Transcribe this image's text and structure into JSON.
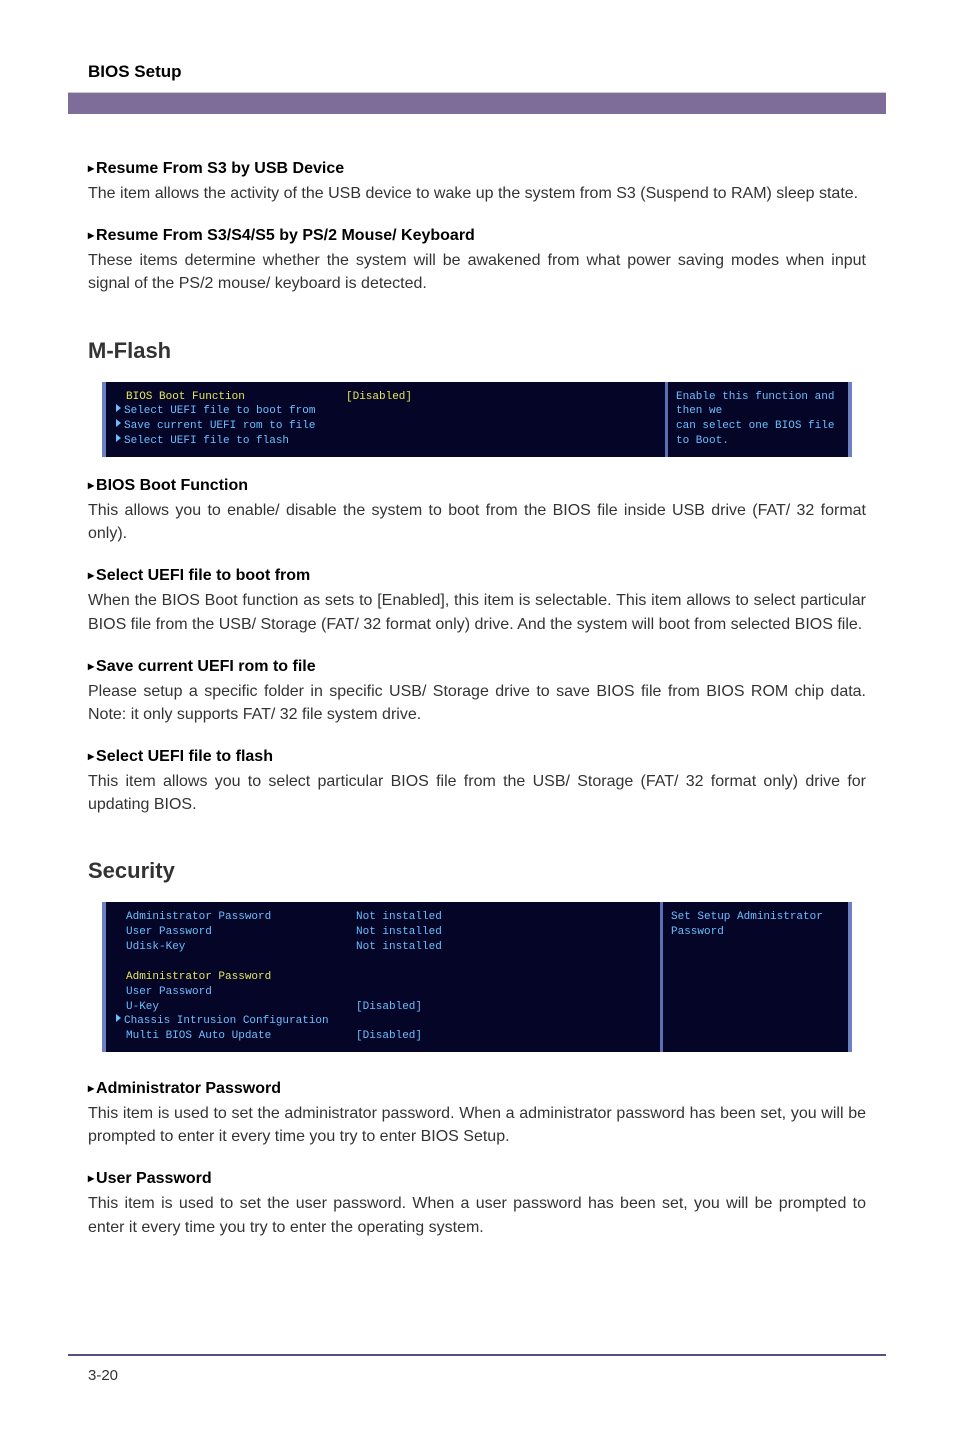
{
  "header": {
    "title": "BIOS Setup"
  },
  "intro": {
    "item1_title": "Resume From S3 by USB Device",
    "item1_text": "The item allows the activity of the USB device to wake up the system from S3 (Suspend to RAM) sleep state.",
    "item2_title": "Resume From S3/S4/S5 by PS/2 Mouse/ Keyboard",
    "item2_text": "These items determine whether the system will be awakened from what power saving modes when input signal of the PS/2 mouse/ keyboard is detected."
  },
  "mflash": {
    "heading": "M-Flash",
    "box": {
      "r1_label": "BIOS Boot Function",
      "r1_value": "[Disabled]",
      "r2_label": "Select UEFI file to boot from",
      "r3_label": "Save current UEFI rom to file",
      "r4_label": "Select UEFI file to flash",
      "help1": "Enable this function and then we",
      "help2": "can select one BIOS file to Boot."
    },
    "item1_title": "BIOS Boot Function",
    "item1_text": "This allows you to enable/ disable the system to boot from the BIOS file inside USB drive (FAT/ 32 format only).",
    "item2_title": "Select UEFI file to boot from",
    "item2_text": "When the BIOS Boot function as sets to [Enabled], this item is selectable. This item allows to select particular BIOS file from the USB/ Storage (FAT/ 32 format only) drive. And the system will boot from selected BIOS file.",
    "item3_title": "Save current UEFI rom to file",
    "item3_text": "Please setup a specific folder in specific USB/ Storage drive to save BIOS file from BIOS ROM chip data. Note: it only supports FAT/ 32 file system drive.",
    "item4_title": "Select UEFI file to flash",
    "item4_text": "This item allows you to select particular BIOS file from the USB/ Storage (FAT/ 32 format only) drive for updating BIOS."
  },
  "security": {
    "heading": "Security",
    "box": {
      "r1_label": "Administrator Password",
      "r1_value": "Not installed",
      "r2_label": "User Password",
      "r2_value": "Not installed",
      "r3_label": "Udisk-Key",
      "r3_value": "Not installed",
      "r5_label": "Administrator Password",
      "r6_label": "User Password",
      "r7_label": "U-Key",
      "r7_value": "[Disabled]",
      "r8_label": "Chassis Intrusion Configuration",
      "r9_label": "Multi BIOS Auto Update",
      "r9_value": "[Disabled]",
      "help": "Set Setup Administrator Password"
    },
    "item1_title": "Administrator Password",
    "item1_text": "This item is used to set the administrator password. When a administrator password has been set, you will be prompted to enter it every time you try to enter BIOS Setup.",
    "item2_title": "User Password",
    "item2_text": "This item is used to set the user password. When a user password has been set, you will be prompted to enter it every time you try to enter the operating system."
  },
  "footer": {
    "page": "3-20"
  }
}
